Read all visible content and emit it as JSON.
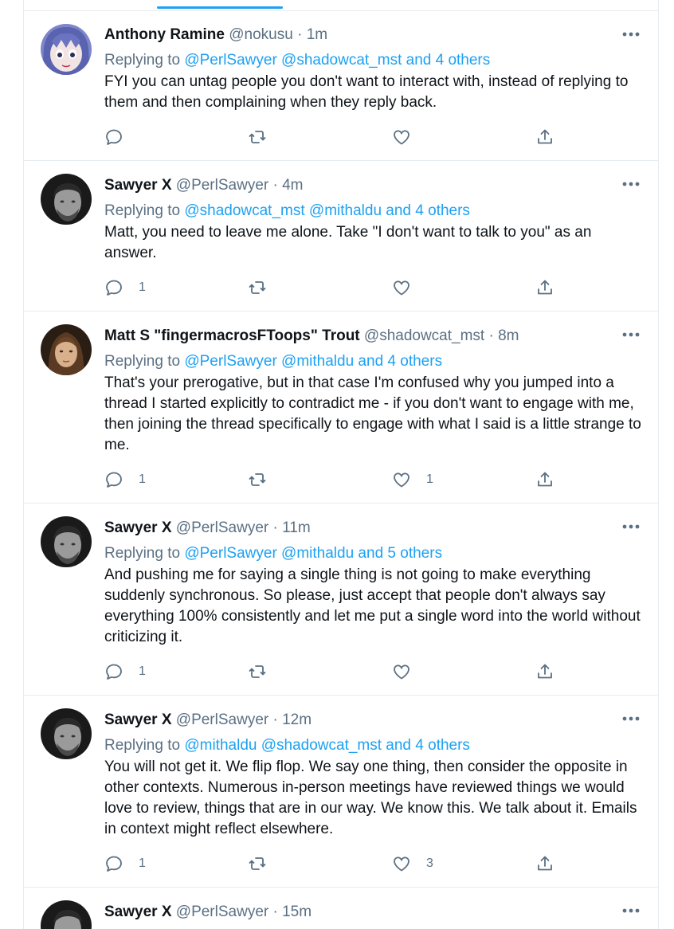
{
  "colors": {
    "accent": "#1da1f2",
    "secondary_text": "#5b7083",
    "border": "#e6ecf0"
  },
  "tweets": [
    {
      "name": "Anthony Ramine",
      "handle": "@nokusu",
      "dot": "·",
      "time": "1m",
      "replying_prefix": "Replying to",
      "replying_to": "@PerlSawyer @shadowcat_mst and 4 others",
      "text": "FYI you can untag people you don't want to interact with, instead of replying to them and then complaining when they reply back.",
      "reply_count": "",
      "like_count": "",
      "avatar": "anime-avatar"
    },
    {
      "name": "Sawyer X",
      "handle": "@PerlSawyer",
      "dot": "·",
      "time": "4m",
      "replying_prefix": "Replying to",
      "replying_to": "@shadowcat_mst @mithaldu and 4 others",
      "text": "Matt, you need to leave me alone. Take \"I don't want to talk to you\" as an answer.",
      "reply_count": "1",
      "like_count": "",
      "avatar": "person-avatar"
    },
    {
      "name": "Matt S \"fingermacrosFToops\" Trout",
      "handle": "@shadowcat_mst",
      "dot": "·",
      "time": "8m",
      "replying_prefix": "Replying to",
      "replying_to": "@PerlSawyer @mithaldu and 4 others",
      "text": "That's your prerogative, but in that case I'm confused why you jumped into a thread I started explicitly to contradict me - if you don't want to engage with me, then joining the thread specifically to engage with what I said is a little strange to me.",
      "reply_count": "1",
      "like_count": "1",
      "avatar": "person-avatar-longhair"
    },
    {
      "name": "Sawyer X",
      "handle": "@PerlSawyer",
      "dot": "·",
      "time": "11m",
      "replying_prefix": "Replying to",
      "replying_to": "@PerlSawyer @mithaldu and 5 others",
      "text": "And pushing me for saying a single thing is not going to make everything suddenly synchronous. So please, just accept that people don't always say everything 100% consistently and let me put a single word into the world without criticizing it.",
      "reply_count": "1",
      "like_count": "",
      "avatar": "person-avatar"
    },
    {
      "name": "Sawyer X",
      "handle": "@PerlSawyer",
      "dot": "·",
      "time": "12m",
      "replying_prefix": "Replying to",
      "replying_to": "@mithaldu @shadowcat_mst and 4 others",
      "text": "You will not get it. We flip flop. We say one thing, then consider the opposite in other contexts. Numerous in-person meetings have reviewed things we would love to review, things that are in our way. We know this. We talk about it. Emails in context might reflect elsewhere.",
      "reply_count": "1",
      "like_count": "3",
      "avatar": "person-avatar"
    },
    {
      "name": "Sawyer X",
      "handle": "@PerlSawyer",
      "dot": "·",
      "time": "15m",
      "avatar": "person-avatar"
    }
  ]
}
